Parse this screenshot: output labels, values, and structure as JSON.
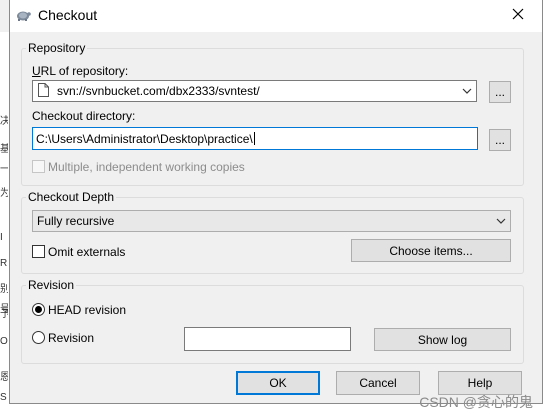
{
  "window": {
    "title": "Checkout",
    "close_symbol": "✕"
  },
  "background": {
    "glyphs": [
      "决",
      "基",
      "一",
      "为",
      "I",
      "R",
      "别",
      "号",
      "予",
      "O",
      "恩",
      "S"
    ]
  },
  "repository": {
    "legend": "Repository",
    "url_label": "URL of repository:",
    "url_value": "svn://svnbucket.com/dbx2333/svntest/",
    "url_browse_label": "...",
    "checkout_dir_label": "Checkout directory:",
    "checkout_dir_value": "C:\\Users\\Administrator\\Desktop\\practice\\",
    "dir_browse_label": "...",
    "multiple_label": "Multiple, independent working copies"
  },
  "depth": {
    "legend": "Checkout Depth",
    "selected": "Fully recursive",
    "omit_label": "Omit externals",
    "choose_items_label": "Choose items..."
  },
  "revision": {
    "legend": "Revision",
    "head_label": "HEAD revision",
    "revision_label": "Revision",
    "revision_value": "",
    "show_log_label": "Show log"
  },
  "buttons": {
    "ok": "OK",
    "cancel": "Cancel",
    "help": "Help"
  },
  "watermark": "CSDN @贪心的鬼"
}
